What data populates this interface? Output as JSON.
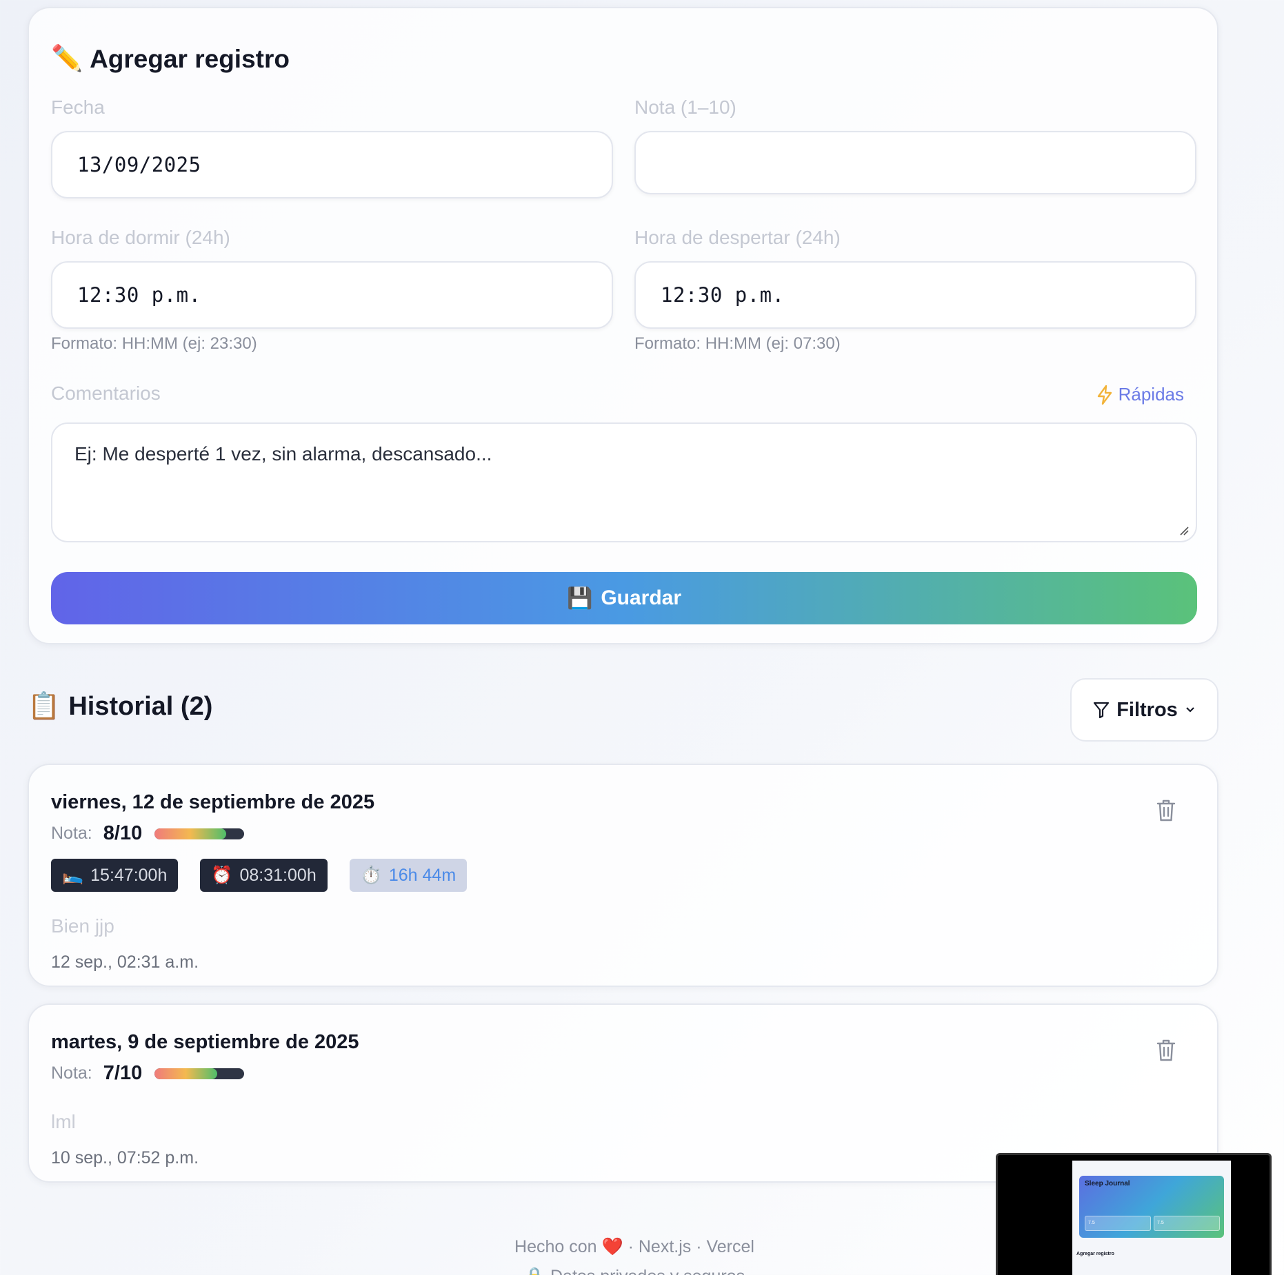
{
  "form": {
    "title": "Agregar registro",
    "title_icon": "✏️",
    "date_label": "Fecha",
    "date_value": "13/09/2025",
    "score_label": "Nota (1–10)",
    "score_value": "",
    "sleep_label": "Hora de dormir (24h)",
    "sleep_value": "12:30 p.m.",
    "sleep_hint": "Formato: HH:MM (ej: 23:30)",
    "wake_label": "Hora de despertar (24h)",
    "wake_value": "12:30 p.m.",
    "wake_hint": "Formato: HH:MM (ej: 07:30)",
    "comments_label": "Comentarios",
    "quick_label": "Rápidas",
    "comments_placeholder": "Ej: Me desperté 1 vez, sin alarma, descansado...",
    "save_label": "Guardar",
    "save_icon": "💾"
  },
  "history": {
    "title": "Historial (2)",
    "title_icon": "📋",
    "filter_label": "Filtros",
    "score_label": "Nota:",
    "entries": [
      {
        "date": "viernes, 12 de septiembre de 2025",
        "score": "8/10",
        "score_fraction": 0.8,
        "bed_icon": "🛌",
        "bed_time": "15:47:00h",
        "alarm_icon": "⏰",
        "wake_time": "08:31:00h",
        "timer_icon": "⏱️",
        "duration": "16h 44m",
        "comment": "Bien jjp",
        "timestamp": "12 sep., 02:31 a.m."
      },
      {
        "date": "martes, 9 de septiembre de 2025",
        "score": "7/10",
        "score_fraction": 0.7,
        "comment": "lml",
        "timestamp": "10 sep., 07:52 p.m."
      }
    ]
  },
  "footer": {
    "made_with": "Hecho con",
    "heart": "❤️",
    "stack": "· Next.js · Vercel",
    "privacy": "🔒 Datos privados y seguros"
  },
  "preview": {
    "app_title": "Sleep Journal",
    "stat_a": "7.5",
    "stat_b": "7.5",
    "section": "Agregar registro"
  },
  "colors": {
    "accent_start": "#6164e8",
    "accent_mid": "#4a9ae3",
    "accent_end": "#5ac27a",
    "chip_dark": "#222838",
    "chip_light": "#cfd5e6"
  }
}
